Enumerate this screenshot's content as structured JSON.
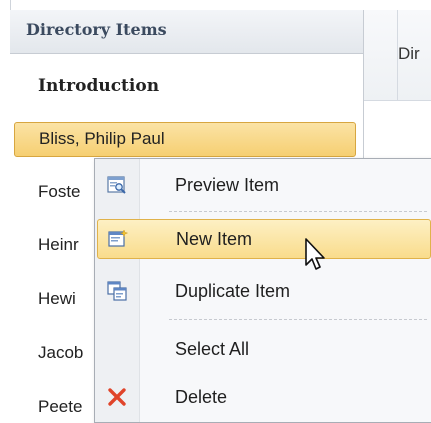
{
  "sidebar": {
    "header": "Directory Items",
    "items": [
      {
        "label": "Introduction"
      },
      {
        "label": "Bliss, Philip Paul"
      },
      {
        "label": "Foste"
      },
      {
        "label": "Heinr"
      },
      {
        "label": "Hewi"
      },
      {
        "label": "Jacob"
      },
      {
        "label": "Peete"
      }
    ]
  },
  "right_pane": {
    "header": "Dir"
  },
  "context_menu": {
    "items": [
      {
        "label": "Preview Item",
        "icon": "preview-item-icon"
      },
      {
        "label": "New Item",
        "icon": "new-item-icon"
      },
      {
        "label": "Duplicate Item",
        "icon": "duplicate-item-icon"
      },
      {
        "label": "Select All",
        "icon": ""
      },
      {
        "label": "Delete",
        "icon": "delete-x-icon"
      }
    ]
  },
  "colors": {
    "selected_bg": "#f6cf72",
    "menu_hover_bg": "#f9dc8c",
    "delete_red": "#e0442a",
    "header_text": "#3b4a5f"
  }
}
